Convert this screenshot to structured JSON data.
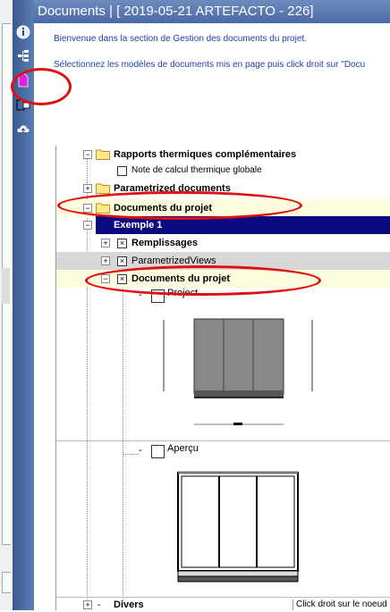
{
  "title": "Documents | [ 2019-05-21 ARTEFACTO - 226]",
  "intro": {
    "line1": "Bienvenue dans la section de Gestion des documents du projet.",
    "line2": "Sélectionnez les modèles de documents mis en page puis click droit sur \"Docu"
  },
  "sidebar_icons": [
    "info-icon",
    "tree-icon",
    "document-icon",
    "export-icon",
    "cloud-icon"
  ],
  "tree": {
    "rapports": "Rapports thermiques complémentaires",
    "note": "Note de calcul thermique globale",
    "parametrized_docs": "Parametrized documents",
    "documents_projet": "Documents du projet",
    "exemple": "Exemple  1",
    "remplissages": "Remplissages",
    "parametrized_views": "ParametrizedViews",
    "documents_projet_child": "Documents du projet",
    "project": "Project",
    "apercu": "Aperçu",
    "divers": "Divers"
  },
  "status_text": "Click droit sur le noeud",
  "colors": {
    "title_bar": "#4a6aa5",
    "highlight_row": "#fffde0",
    "selected_row": "#0a0a80",
    "annotation": "#e01010"
  }
}
